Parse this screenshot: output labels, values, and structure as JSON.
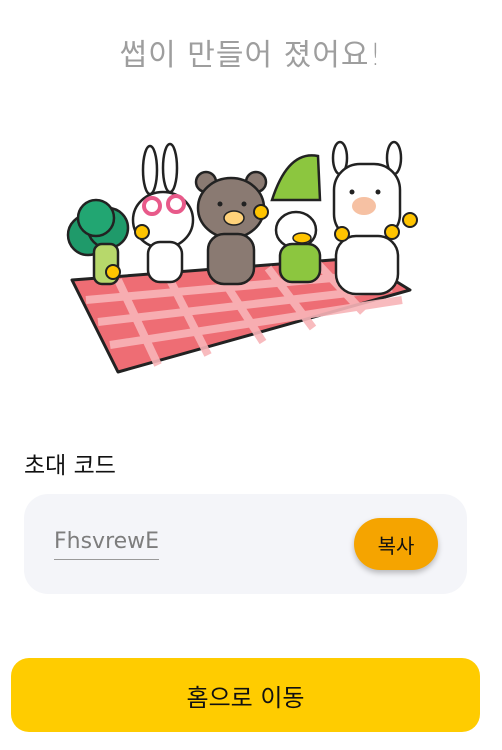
{
  "header": {
    "title": "썹이 만들어 졌어요!"
  },
  "illustration": {
    "icon": "picnic-characters-illustration",
    "colors": {
      "blanket": "#e8505b",
      "blanket_light": "#f7a6ab",
      "bear": "#8a7a72",
      "crocodile": "#8cc63f",
      "broccoli": "#2e9e6e",
      "accent": "#ffc400"
    }
  },
  "invite": {
    "label": "초대 코드",
    "code": "FhsvrewE",
    "copy_label": "복사"
  },
  "footer": {
    "home_label": "홈으로 이동"
  },
  "colors": {
    "primary": "#ffcc00",
    "copy_button": "#f5a400",
    "code_box_bg": "#f4f5f9",
    "title_text": "#9e9e9e"
  }
}
